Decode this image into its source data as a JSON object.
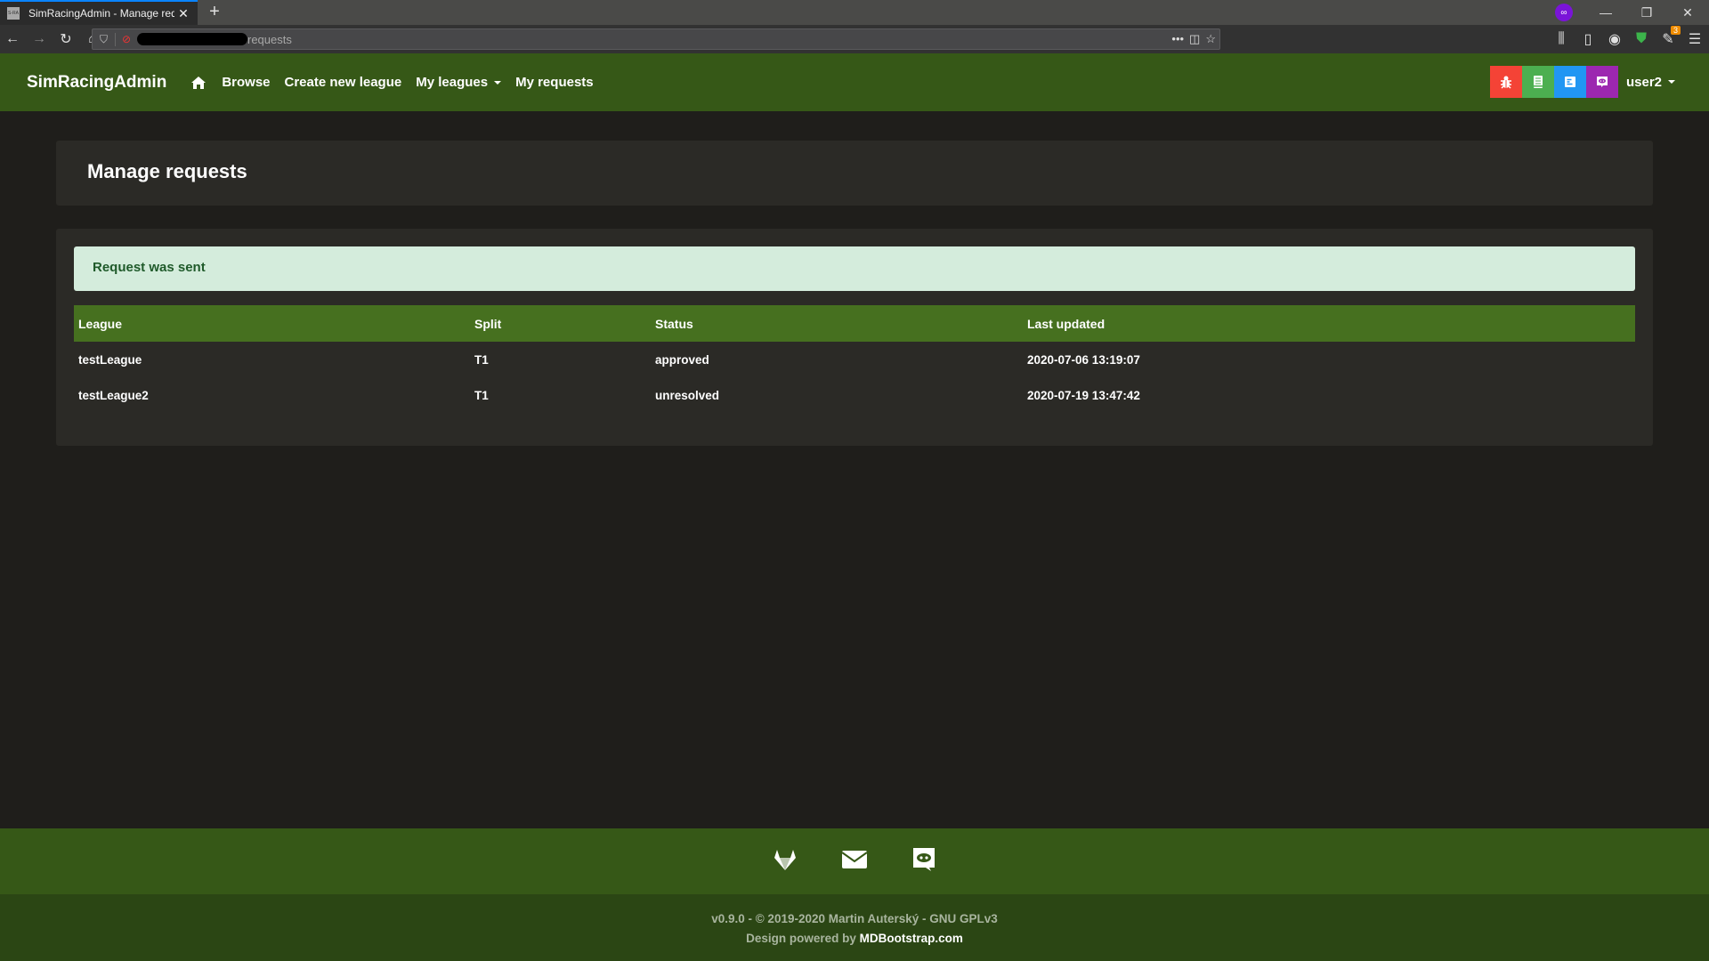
{
  "browser": {
    "tab_title": "SimRacingAdmin - Manage requests",
    "tab_favicon": "S-RA",
    "url_visible": "requests",
    "extension_badge": "3"
  },
  "navbar": {
    "brand": "SimRacingAdmin",
    "links": [
      {
        "label": "Browse"
      },
      {
        "label": "Create new league"
      },
      {
        "label": "My leagues"
      },
      {
        "label": "My requests"
      }
    ],
    "buttons": [
      {
        "icon": "bug-icon",
        "color": "#f44336"
      },
      {
        "icon": "book-icon",
        "color": "#4caf50"
      },
      {
        "icon": "docs-icon",
        "color": "#2196f3"
      },
      {
        "icon": "discord-icon",
        "color": "#9c27b0"
      }
    ],
    "user": "user2"
  },
  "page": {
    "title": "Manage requests",
    "alert": "Request was sent"
  },
  "table": {
    "headers": [
      "League",
      "Split",
      "Status",
      "Last updated"
    ],
    "rows": [
      [
        "testLeague",
        "T1",
        "approved",
        "2020-07-06 13:19:07"
      ],
      [
        "testLeague2",
        "T1",
        "unresolved",
        "2020-07-19 13:47:42"
      ]
    ]
  },
  "footer": {
    "icons": [
      "gitlab-icon",
      "mail-icon",
      "discord-icon"
    ],
    "copyright": "v0.9.0 - © 2019-2020 Martin Auterský - GNU GPLv3",
    "design_prefix": "Design powered by ",
    "design_link": "MDBootstrap.com"
  }
}
